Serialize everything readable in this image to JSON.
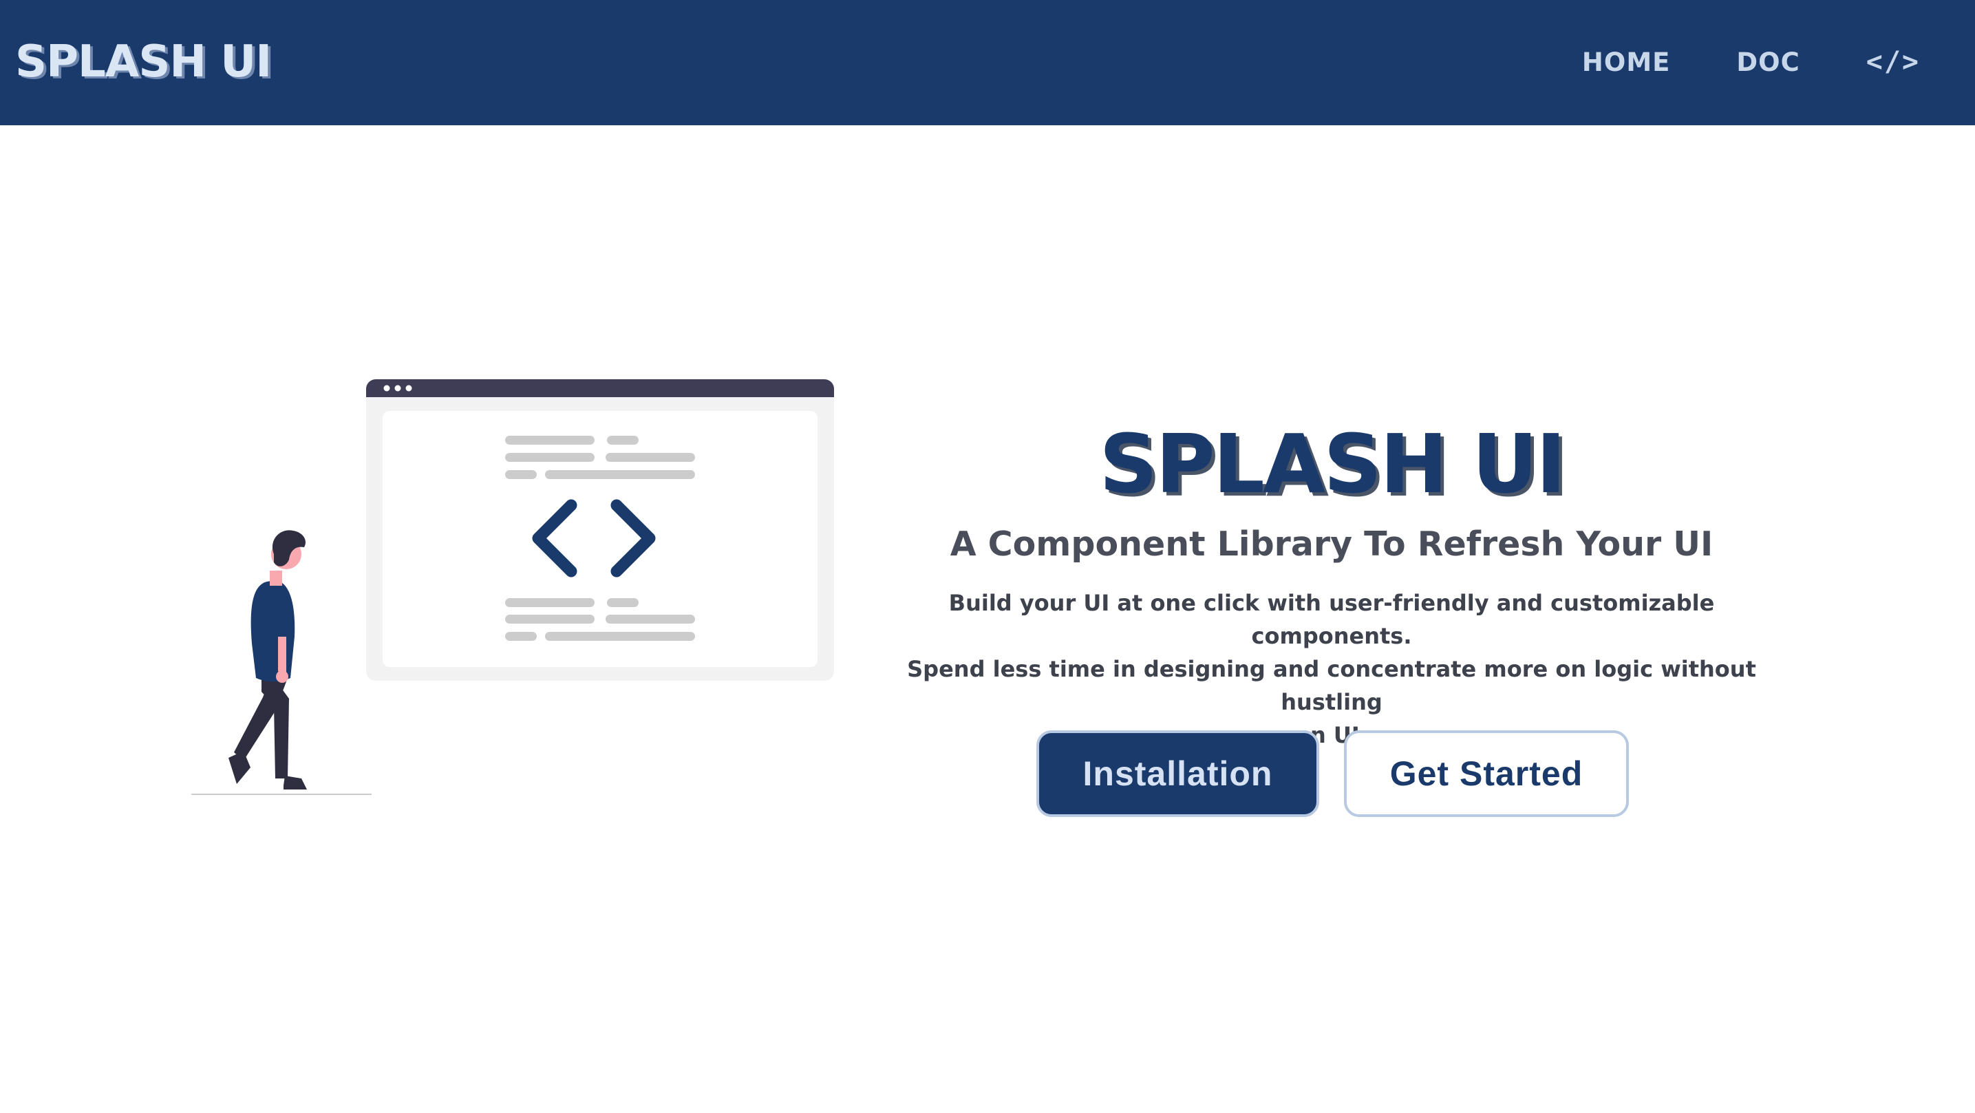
{
  "navbar": {
    "brand": "SPLASH UI",
    "links": [
      {
        "label": "HOME"
      },
      {
        "label": "DOC"
      }
    ],
    "code_icon_label": "</>"
  },
  "hero": {
    "title": "SPLASH UI",
    "subtitle": "A Component Library To Refresh Your UI",
    "description_lines": [
      "Build your UI at one click with user-friendly and customizable components.",
      "Spend less time in designing and concentrate more on logic without hustling",
      "on UI."
    ],
    "buttons": {
      "installation": "Installation",
      "get_started": "Get Started"
    }
  },
  "illustration": {
    "icon": "code-brackets-icon",
    "figure": "walking-person-illustration"
  },
  "colors": {
    "primary": "#1a3a6b",
    "nav_text": "#c8d6ea",
    "text_gray": "#4a4e5a",
    "window_bar": "#3f3d56",
    "placeholder_line": "#cccccc",
    "window_bg": "#f2f2f2"
  }
}
